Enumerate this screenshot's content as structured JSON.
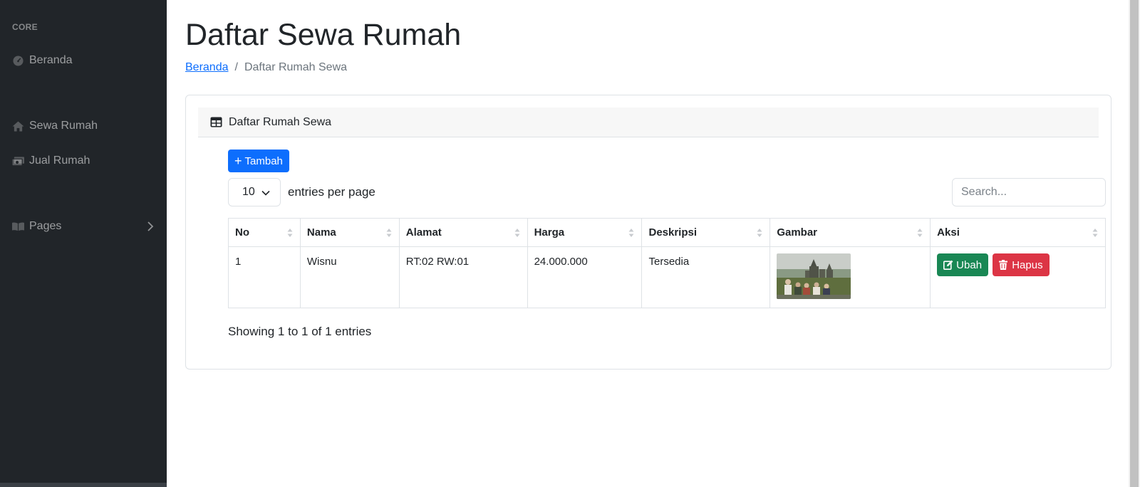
{
  "sidebar": {
    "heading": "CORE",
    "items": [
      {
        "label": "Beranda",
        "icon": "tachometer-icon"
      },
      {
        "label": "Sewa Rumah",
        "icon": "home-icon"
      },
      {
        "label": "Jual Rumah",
        "icon": "money-bill-icon"
      },
      {
        "label": "Pages",
        "icon": "book-open-icon"
      }
    ]
  },
  "header": {
    "title": "Daftar Sewa Rumah",
    "breadcrumb": {
      "home": "Beranda",
      "current": "Daftar Rumah Sewa"
    }
  },
  "card": {
    "title": "Daftar Rumah Sewa",
    "add_button": "Tambah",
    "entries_value": "10",
    "entries_label": "entries per page",
    "search_placeholder": "Search...",
    "columns": [
      "No",
      "Nama",
      "Alamat",
      "Harga",
      "Deskripsi",
      "Gambar",
      "Aksi"
    ],
    "rows": [
      {
        "no": "1",
        "nama": "Wisnu",
        "alamat": "RT:02 RW:01",
        "harga": "24.000.000",
        "deskripsi": "Tersedia",
        "edit_label": "Ubah",
        "delete_label": "Hapus"
      }
    ],
    "showing": "Showing 1 to 1 of 1 entries"
  },
  "colors": {
    "sidebar_bg": "#212529",
    "primary": "#0d6efd",
    "success": "#198754",
    "danger": "#dc3545"
  }
}
